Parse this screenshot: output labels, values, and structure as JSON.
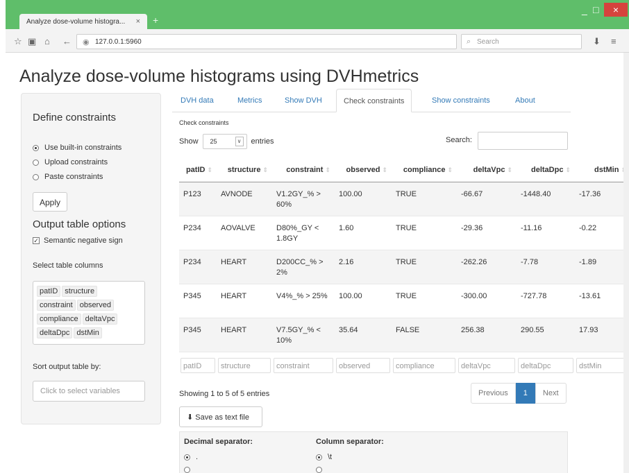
{
  "browser": {
    "tab_title": "Analyze dose-volume histogra...",
    "tab_close": "×",
    "new_tab": "+",
    "url": "127.0.0.1:5960",
    "search_placeholder": "Search",
    "minimize": "_",
    "maximize": "□",
    "close": "×"
  },
  "page": {
    "title": "Analyze dose-volume histograms using DVHmetrics"
  },
  "sidebar": {
    "define_heading": "Define constraints",
    "radio_options": [
      {
        "label": "Use built-in constraints",
        "selected": true
      },
      {
        "label": "Upload constraints",
        "selected": false
      },
      {
        "label": "Paste constraints",
        "selected": false
      }
    ],
    "apply_label": "Apply",
    "output_heading": "Output table options",
    "semantic_label": "Semantic negative sign",
    "semantic_checked": true,
    "select_cols_label": "Select table columns",
    "columns": [
      "patID",
      "structure",
      "constraint",
      "observed",
      "compliance",
      "deltaVpc",
      "deltaDpc",
      "dstMin"
    ],
    "sort_label": "Sort output table by:",
    "sort_placeholder": "Click to select variables"
  },
  "tabs": [
    {
      "label": "DVH data",
      "active": false
    },
    {
      "label": "Metrics",
      "active": false
    },
    {
      "label": "Show DVH",
      "active": false
    },
    {
      "label": "Check constraints",
      "active": true
    },
    {
      "label": "Show constraints",
      "active": false
    },
    {
      "label": "About",
      "active": false
    }
  ],
  "main": {
    "section_label": "Check constraints",
    "show_label": "Show",
    "entries_value": "25",
    "entries_label": "entries",
    "search_label": "Search:",
    "headers": [
      "patID",
      "structure",
      "constraint",
      "observed",
      "compliance",
      "deltaVpc",
      "deltaDpc",
      "dstMin"
    ],
    "rows": [
      [
        "P123",
        "AVNODE",
        "V1.2GY_% > 60%",
        "100.00",
        "TRUE",
        "-66.67",
        "-1448.40",
        "-17.36"
      ],
      [
        "P234",
        "AOVALVE",
        "D80%_GY < 1.8GY",
        "1.60",
        "TRUE",
        "-29.36",
        "-11.16",
        "-0.22"
      ],
      [
        "P234",
        "HEART",
        "D200CC_% > 2%",
        "2.16",
        "TRUE",
        "-262.26",
        "-7.78",
        "-1.89"
      ],
      [
        "P345",
        "HEART",
        "V4%_% > 25%",
        "100.00",
        "TRUE",
        "-300.00",
        "-727.78",
        "-13.61"
      ],
      [
        "P345",
        "HEART",
        "V7.5GY_% < 10%",
        "35.64",
        "FALSE",
        "256.38",
        "290.55",
        "17.93"
      ]
    ],
    "filters": [
      "patID",
      "structure",
      "constraint",
      "observed",
      "compliance",
      "deltaVpc",
      "deltaDpc",
      "dstMin"
    ],
    "info": "Showing 1 to 5 of 5 entries",
    "prev_label": "Previous",
    "page_num": "1",
    "next_label": "Next",
    "save_label": "Save as text file",
    "decimal_label": "Decimal separator:",
    "decimal_option": ".",
    "column_label": "Column separator:",
    "column_option": "\\t"
  }
}
